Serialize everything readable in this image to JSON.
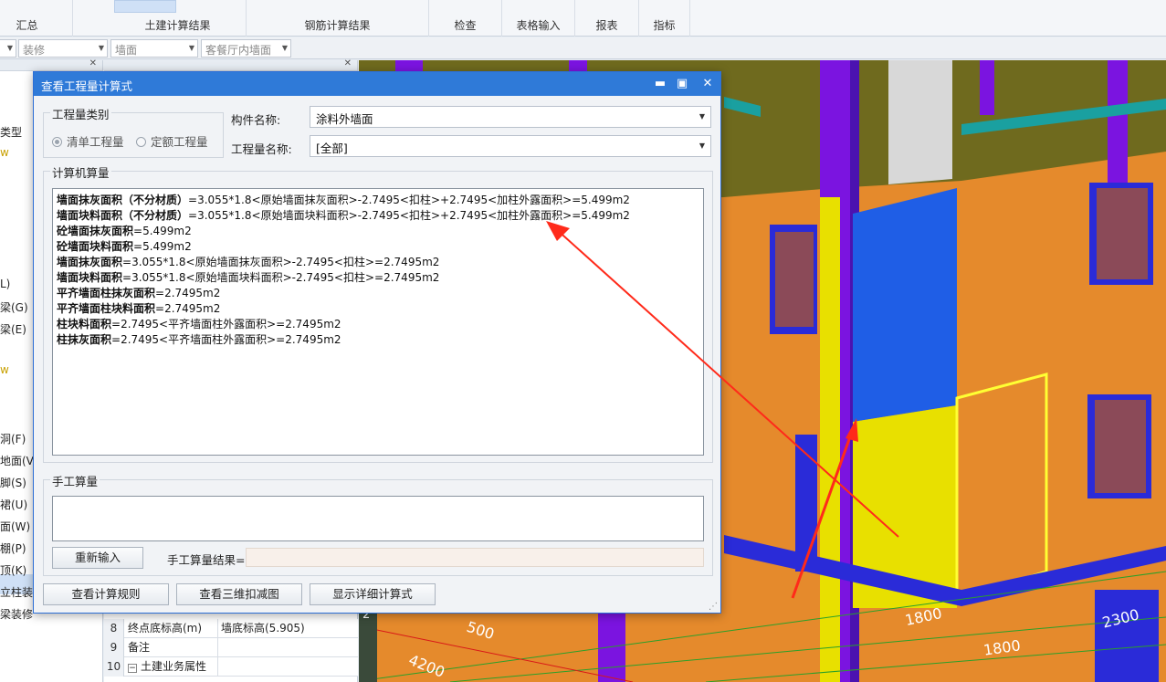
{
  "ribbon": {
    "groups": [
      {
        "label": "汇总"
      },
      {
        "label": "土建计算结果"
      },
      {
        "label": "钢筋计算结果"
      },
      {
        "label": "检查"
      },
      {
        "label": "表格输入"
      },
      {
        "label": "报表"
      },
      {
        "label": "指标"
      }
    ]
  },
  "filterbar": {
    "combo1": "装修",
    "combo2": "墙面",
    "combo3": "客餐厅内墙面"
  },
  "leftpanel": {
    "items": [
      "类型",
      "w",
      "L)",
      "梁(G)",
      "梁(E)",
      "w",
      "洞(F)",
      "地面(V)",
      "脚(S)",
      "裙(U)",
      "面(W)",
      "棚(P)",
      "顶(K)",
      "立柱装修",
      "梁装修"
    ]
  },
  "propgrid": {
    "rows": [
      {
        "num": "8",
        "key": "终点底标高(m)",
        "value": "墙底标高(5.905)"
      },
      {
        "num": "9",
        "key": "备注",
        "value": ""
      },
      {
        "num": "10",
        "key": "土建业务属性",
        "value": ""
      }
    ]
  },
  "viewport": {
    "dims": [
      "500",
      "1800",
      "1800",
      "2300",
      "4200"
    ],
    "corner_label": "2"
  },
  "dialog": {
    "title": "查看工程量计算式",
    "qty_type_group": "工程量类别",
    "radio_list": "清单工程量",
    "radio_quota": "定额工程量",
    "component_label": "构件名称:",
    "component_value": "涂料外墙面",
    "qty_name_label": "工程量名称:",
    "qty_name_value": "[全部]",
    "computer_group": "计算机算量",
    "lines": [
      {
        "name": "墙面抹灰面积（不分材质）",
        "expr": "=3.055*1.8<原始墙面抹灰面积>-2.7495<扣柱>+2.7495<加柱外露面积>=5.499m2"
      },
      {
        "name": "墙面块料面积（不分材质）",
        "expr": "=3.055*1.8<原始墙面块料面积>-2.7495<扣柱>+2.7495<加柱外露面积>=5.499m2"
      },
      {
        "name": "砼墙面抹灰面积",
        "expr": "=5.499m2"
      },
      {
        "name": "砼墙面块料面积",
        "expr": "=5.499m2"
      },
      {
        "name": "墙面抹灰面积",
        "expr": "=3.055*1.8<原始墙面抹灰面积>-2.7495<扣柱>=2.7495m2"
      },
      {
        "name": "墙面块料面积",
        "expr": "=3.055*1.8<原始墙面块料面积>-2.7495<扣柱>=2.7495m2"
      },
      {
        "name": "平齐墙面柱抹灰面积",
        "expr": "=2.7495m2"
      },
      {
        "name": "平齐墙面柱块料面积",
        "expr": "=2.7495m2"
      },
      {
        "name": "柱块料面积",
        "expr": "=2.7495<平齐墙面柱外露面积>=2.7495m2"
      },
      {
        "name": "柱抹灰面积",
        "expr": "=2.7495<平齐墙面柱外露面积>=2.7495m2"
      }
    ],
    "manual_group": "手工算量",
    "reenter_button": "重新输入",
    "manual_result_label": "手工算量结果=",
    "btn_rules": "查看计算规则",
    "btn_3d": "查看三维扣减图",
    "btn_detail": "显示详细计算式"
  }
}
